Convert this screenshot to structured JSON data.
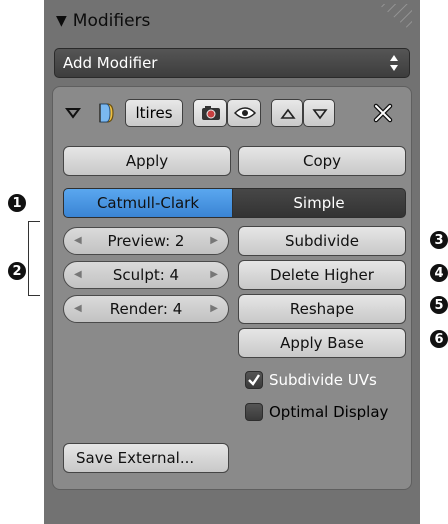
{
  "panel": {
    "title": "Modifiers",
    "add_modifier_label": "Add Modifier"
  },
  "modifier": {
    "name": "ltires",
    "apply_label": "Apply",
    "copy_label": "Copy",
    "subdivision_types": [
      "Catmull-Clark",
      "Simple"
    ],
    "active_type": "Catmull-Clark",
    "preview_label": "Preview: 2",
    "sculpt_label": "Sculpt: 4",
    "render_label": "Render: 4",
    "subdivide_label": "Subdivide",
    "delete_higher_label": "Delete Higher",
    "reshape_label": "Reshape",
    "apply_base_label": "Apply Base",
    "subdivide_uvs_label": "Subdivide UVs",
    "subdivide_uvs_checked": true,
    "optimal_display_label": "Optimal Display",
    "optimal_display_checked": false,
    "save_external_label": "Save External..."
  },
  "callouts": [
    "1",
    "2",
    "3",
    "4",
    "5",
    "6"
  ],
  "colors": {
    "active_segment": "#4a95e2",
    "panel_bg": "#727272",
    "box_bg": "#8a8a8a"
  },
  "icons": [
    "collapse-triangle-icon",
    "modifier-type-icon",
    "render-camera-icon",
    "viewport-eye-icon",
    "move-up-icon",
    "move-down-icon",
    "delete-x-icon"
  ]
}
